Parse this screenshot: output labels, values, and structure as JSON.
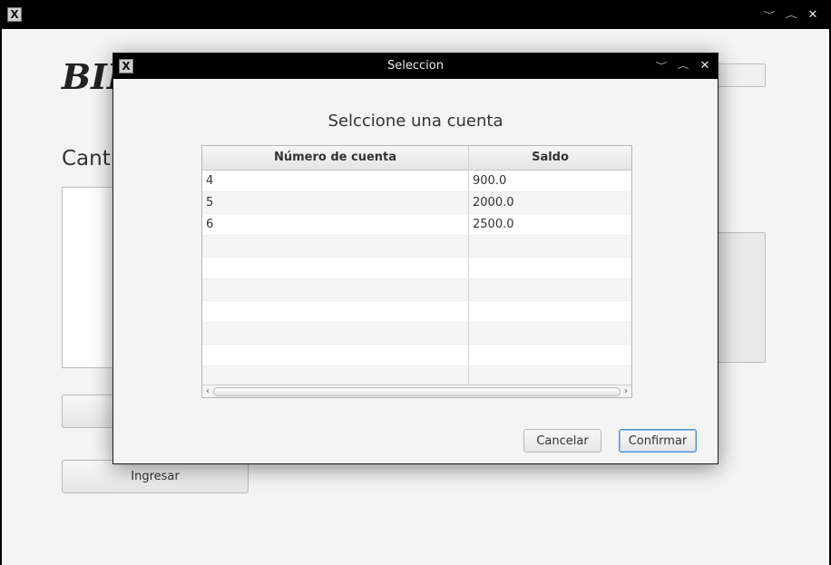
{
  "main_window": {
    "title_partial": "BII",
    "amount_label_partial": "Canti",
    "ingresar_button": "Ingresar"
  },
  "dialog": {
    "title": "Seleccion",
    "heading": "Selccione una cuenta",
    "table": {
      "columns": [
        "Número de cuenta",
        "Saldo"
      ],
      "rows": [
        {
          "account": "4",
          "balance": "900.0"
        },
        {
          "account": "5",
          "balance": "2000.0"
        },
        {
          "account": "6",
          "balance": "2500.0"
        }
      ]
    },
    "cancel_button": "Cancelar",
    "confirm_button": "Confirmar"
  },
  "icons": {
    "app": "x-app-icon",
    "minimize": "chevron-down-icon",
    "maximize": "chevron-up-icon",
    "close": "close-icon"
  }
}
